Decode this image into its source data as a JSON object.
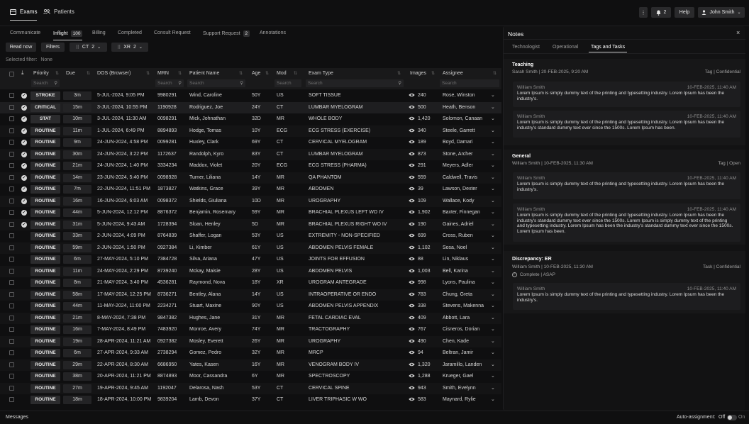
{
  "topbar": {
    "tabs": [
      {
        "label": "Exams"
      },
      {
        "label": "Patients"
      }
    ],
    "more_label": "⋮",
    "notif_count": "2",
    "help_label": "Help",
    "user_name": "John Smith"
  },
  "subtabs": [
    {
      "label": "Communicate",
      "count": ""
    },
    {
      "label": "Inflight",
      "count": "100"
    },
    {
      "label": "Billing",
      "count": ""
    },
    {
      "label": "Completed",
      "count": ""
    },
    {
      "label": "Consult Request",
      "count": ""
    },
    {
      "label": "Support Request",
      "count": "2"
    },
    {
      "label": "Annotations",
      "count": ""
    }
  ],
  "filters": {
    "read_now": "Read now",
    "filters": "Filters",
    "chip1_label": "CT",
    "chip1_count": "2",
    "chip2_label": "XR",
    "chip2_count": "2",
    "selected_filter_label": "Selected filter:",
    "selected_filter_value": "None"
  },
  "columns": {
    "priority": "Priority",
    "due": "Due",
    "dos": "DOS (Browser)",
    "mrn": "MRN",
    "patient": "Patient Name",
    "age": "Age",
    "mod": "Mod",
    "exam": "Exam Type",
    "images": "Images",
    "assignee": "Assignee",
    "search_placeholder": "Search"
  },
  "rows": [
    {
      "checked": true,
      "priority": "STROKE",
      "due": "3m",
      "dos": "5-JUL-2024, 9:05 PM",
      "mrn": "9980291",
      "patient": "Wind, Caroline",
      "age": "50Y",
      "mod": "US",
      "exam": "SOFT TISSUE",
      "images": "240",
      "assignee": "Rose, Winston"
    },
    {
      "checked": true,
      "priority": "CRITICAL",
      "due": "15m",
      "dos": "3-JUL-2024, 10:55 PM",
      "mrn": "1190928",
      "patient": "Rodriguez, Joe",
      "age": "24Y",
      "mod": "CT",
      "exam": "LUMBAR MYELOGRAM",
      "images": "500",
      "assignee": "Heath, Benson"
    },
    {
      "checked": true,
      "priority": "STAT",
      "due": "10m",
      "dos": "3-JUL-2024, 11:30 AM",
      "mrn": "0098291",
      "patient": "Mick, Johnathan",
      "age": "32D",
      "mod": "MR",
      "exam": "WHOLE BODY",
      "images": "1,420",
      "assignee": "Solomon, Canaan"
    },
    {
      "checked": true,
      "priority": "ROUTINE",
      "due": "11m",
      "dos": "1-JUL-2024, 6:49 PM",
      "mrn": "8894893",
      "patient": "Hodge, Tomas",
      "age": "10Y",
      "mod": "ECG",
      "exam": "ECG STRESS (EXERCISE)",
      "images": "340",
      "assignee": "Steele, Garrett"
    },
    {
      "checked": true,
      "priority": "ROUTINE",
      "due": "9m",
      "dos": "24-JUN-2024, 4:58 PM",
      "mrn": "0099281",
      "patient": "Huxley, Clark",
      "age": "69Y",
      "mod": "CT",
      "exam": "CERVICAL MYELOGRAM",
      "images": "189",
      "assignee": "Boyd, Damari"
    },
    {
      "checked": true,
      "priority": "ROUTINE",
      "due": "30m",
      "dos": "24-JUN-2024, 3:22 PM",
      "mrn": "1172637",
      "patient": "Randolph, Kyro",
      "age": "83Y",
      "mod": "CT",
      "exam": "LUMBAR MYELOGRAM",
      "images": "873",
      "assignee": "Stone, Archer"
    },
    {
      "checked": true,
      "priority": "ROUTINE",
      "due": "21m",
      "dos": "24-JUN-2024, 1:40 PM",
      "mrn": "3334234",
      "patient": "Maddox, Violet",
      "age": "20Y",
      "mod": "ECG",
      "exam": "ECG STRESS (PHARMA)",
      "images": "291",
      "assignee": "Meyers, Adler"
    },
    {
      "checked": true,
      "priority": "ROUTINE",
      "due": "14m",
      "dos": "23-JUN-2024, 5:40 PM",
      "mrn": "0098928",
      "patient": "Turner, Liliana",
      "age": "14Y",
      "mod": "MR",
      "exam": "QA PHANTOM",
      "images": "559",
      "assignee": "Caldwell, Travis"
    },
    {
      "checked": true,
      "priority": "ROUTINE",
      "due": "7m",
      "dos": "22-JUN-2024, 11:51 PM",
      "mrn": "1873827",
      "patient": "Watkins, Grace",
      "age": "39Y",
      "mod": "MR",
      "exam": "ABDOMEN",
      "images": "39",
      "assignee": "Lawson, Dexter"
    },
    {
      "checked": true,
      "priority": "ROUTINE",
      "due": "16m",
      "dos": "16-JUN-2024, 6:03 AM",
      "mrn": "0098372",
      "patient": "Shields, Giuliana",
      "age": "10D",
      "mod": "MR",
      "exam": "UROGRAPHY",
      "images": "109",
      "assignee": "Wallace, Kody"
    },
    {
      "checked": true,
      "priority": "ROUTINE",
      "due": "44m",
      "dos": "5-JUN-2024, 12:12 PM",
      "mrn": "8876372",
      "patient": "Benjamin, Rosemary",
      "age": "59Y",
      "mod": "MR",
      "exam": "BRACHIAL PLEXUS LEFT WO IV",
      "images": "1,902",
      "assignee": "Baxter, Finnegan"
    },
    {
      "checked": true,
      "priority": "ROUTINE",
      "due": "31m",
      "dos": "5-JUN-2024, 9:43 AM",
      "mrn": "1728394",
      "patient": "Sloan, Henley",
      "age": "5D",
      "mod": "MR",
      "exam": "BRACHIAL PLEXUS RIGHT WO IV",
      "images": "190",
      "assignee": "Gaines, Adriel"
    },
    {
      "checked": false,
      "priority": "ROUTINE",
      "due": "33m",
      "dos": "2-JUN-2024, 4:09 PM",
      "mrn": "8764839",
      "patient": "Shaffer, Logan",
      "age": "53Y",
      "mod": "US",
      "exam": "EXTREMITY - NON-SPECIFIED",
      "images": "699",
      "assignee": "Cross, Ruben"
    },
    {
      "checked": false,
      "priority": "ROUTINE",
      "due": "59m",
      "dos": "2-JUN-2024, 1:50 PM",
      "mrn": "0927384",
      "patient": "Li, Kimber",
      "age": "61Y",
      "mod": "US",
      "exam": "ABDOMEN PELVIS FEMALE",
      "images": "1,102",
      "assignee": "Sosa, Noel"
    },
    {
      "checked": false,
      "priority": "ROUTINE",
      "due": "6m",
      "dos": "27-MAY-2024, 5:10 PM",
      "mrn": "7384728",
      "patient": "Silva, Ariana",
      "age": "47Y",
      "mod": "US",
      "exam": "JOINTS FOR EFFUSION",
      "images": "88",
      "assignee": "Lin, Niklaus"
    },
    {
      "checked": false,
      "priority": "ROUTINE",
      "due": "11m",
      "dos": "24-MAY-2024, 2:29 PM",
      "mrn": "8739240",
      "patient": "Mckay, Maisie",
      "age": "28Y",
      "mod": "US",
      "exam": "ABDOMEN PELVIS",
      "images": "1,003",
      "assignee": "Bell, Karina"
    },
    {
      "checked": false,
      "priority": "ROUTINE",
      "due": "8m",
      "dos": "21-MAY-2024, 3:40 PM",
      "mrn": "4536281",
      "patient": "Raymond, Nova",
      "age": "18Y",
      "mod": "XR",
      "exam": "UROGRAM ANTEGRADE",
      "images": "998",
      "assignee": "Lyons, Paulina"
    },
    {
      "checked": false,
      "priority": "ROUTINE",
      "due": "58m",
      "dos": "17-MAY-2024, 12:25 PM",
      "mrn": "8736271",
      "patient": "Bentley, Alana",
      "age": "14Y",
      "mod": "US",
      "exam": "INTRAOPERATIVE OR ENDO",
      "images": "783",
      "assignee": "Chung, Greta"
    },
    {
      "checked": false,
      "priority": "ROUTINE",
      "due": "44m",
      "dos": "11-MAY-2024, 11:00 PM",
      "mrn": "2234271",
      "patient": "Stuart, Maxine",
      "age": "90Y",
      "mod": "US",
      "exam": "ABDOMEN PELVIS APPENDIX",
      "images": "338",
      "assignee": "Stevens, Makenna"
    },
    {
      "checked": false,
      "priority": "ROUTINE",
      "due": "21m",
      "dos": "8-MAY-2024, 7:38 PM",
      "mrn": "9847382",
      "patient": "Hughes, Jane",
      "age": "31Y",
      "mod": "MR",
      "exam": "FETAL CARDIAC EVAL",
      "images": "409",
      "assignee": "Abbott, Lara"
    },
    {
      "checked": false,
      "priority": "ROUTINE",
      "due": "16m",
      "dos": "7-MAY-2024, 8:49 PM",
      "mrn": "7483920",
      "patient": "Monroe, Avery",
      "age": "74Y",
      "mod": "MR",
      "exam": "TRACTOGRAPHY",
      "images": "767",
      "assignee": "Cisneros, Dorian"
    },
    {
      "checked": false,
      "priority": "ROUTINE",
      "due": "19m",
      "dos": "28-APR-2024, 11:21 AM",
      "mrn": "0927382",
      "patient": "Mosley, Everett",
      "age": "26Y",
      "mod": "MR",
      "exam": "UROGRAPHY",
      "images": "490",
      "assignee": "Chen, Kade"
    },
    {
      "checked": false,
      "priority": "ROUTINE",
      "due": "6m",
      "dos": "27-APR-2024, 9:33 AM",
      "mrn": "2738294",
      "patient": "Gomez, Pedro",
      "age": "32Y",
      "mod": "MR",
      "exam": "MRCP",
      "images": "94",
      "assignee": "Beltran, Jamir"
    },
    {
      "checked": false,
      "priority": "ROUTINE",
      "due": "29m",
      "dos": "22-APR-2024, 8:30 AM",
      "mrn": "6686950",
      "patient": "Yates, Kasen",
      "age": "16Y",
      "mod": "MR",
      "exam": "VENOGRAM BODY IV",
      "images": "1,320",
      "assignee": "Jaramillo, Landen"
    },
    {
      "checked": false,
      "priority": "ROUTINE",
      "due": "38m",
      "dos": "20-APR-2024, 11:21 PM",
      "mrn": "8874893",
      "patient": "Moor, Cassandra",
      "age": "6Y",
      "mod": "MR",
      "exam": "SPECTROSCOPY",
      "images": "1,288",
      "assignee": "Krueger, Gael"
    },
    {
      "checked": false,
      "priority": "ROUTINE",
      "due": "27m",
      "dos": "19-APR-2024, 9:45 AM",
      "mrn": "1192047",
      "patient": "Delarosa, Nash",
      "age": "53Y",
      "mod": "CT",
      "exam": "CERVICAL SPINE",
      "images": "943",
      "assignee": "Smith, Evelynn"
    },
    {
      "checked": false,
      "priority": "ROUTINE",
      "due": "18m",
      "dos": "18-APR-2024, 10:00 PM",
      "mrn": "9839204",
      "patient": "Lamb, Devon",
      "age": "37Y",
      "mod": "CT",
      "exam": "LIVER TRIPHASIC W WO",
      "images": "583",
      "assignee": "Maynard, Rylie"
    }
  ],
  "bottom": {
    "messages": "Messages",
    "auto_label": "Auto-assignment:",
    "off": "Off",
    "on": "On"
  },
  "notes": {
    "title": "Notes",
    "close": "×",
    "tabs": [
      {
        "label": "Technologist"
      },
      {
        "label": "Operational"
      },
      {
        "label": "Tags and Tasks"
      }
    ],
    "groups": [
      {
        "title": "Teaching",
        "meta": "Sarah Smith | 20-FEB-2025, 9:20 AM",
        "tag": "Tag | Confidential",
        "status": "",
        "cards": [
          {
            "author": "William Smith",
            "date": "10-FEB-2025, 11:40 AM",
            "text": "Lorem Ipsum is simply dummy text of the printing and typesetting industry. Lorem Ipsum has been the industry's."
          },
          {
            "author": "William Smith",
            "date": "10-FEB-2025, 11:40 AM",
            "text": "Lorem Ipsum is simply dummy text of the printing and typesetting industry. Lorem Ipsum has been the industry's standard dummy text ever since the 1500s. Lorem Ipsum has been."
          }
        ]
      },
      {
        "title": "General",
        "meta": "William Smith | 10-FEB-2025, 11:30 AM",
        "tag": "Tag | Open",
        "status": "",
        "cards": [
          {
            "author": "William Smith",
            "date": "10-FEB-2025, 11:40 AM",
            "text": "Lorem Ipsum is simply dummy text of the printing and typesetting industry. Lorem Ipsum has been the industry's."
          },
          {
            "author": "William Smith",
            "date": "10-FEB-2025, 11:40 AM",
            "text": "Lorem Ipsum is simply dummy text of the printing and typesetting industry. Lorem Ipsum has been the industry's standard dummy text ever since the 1500s. Lorem Ipsum is simply dummy text of the printing and typesetting industry. Lorem Ipsum has been the industry's standard dummy text ever since the 1500s. Lorem Ipsum has been."
          }
        ]
      },
      {
        "title": "Discrepancy: ER",
        "meta": "William Smith | 10-FEB-2025, 11:30 AM",
        "tag": "Task | Confidential",
        "status": "Complete | ASAP",
        "cards": [
          {
            "author": "William Smith",
            "date": "10-FEB-2025, 11:40 AM",
            "text": "Lorem Ipsum is simply dummy text of the printing and typesetting industry. Lorem Ipsum has been the industry's."
          }
        ]
      }
    ]
  }
}
